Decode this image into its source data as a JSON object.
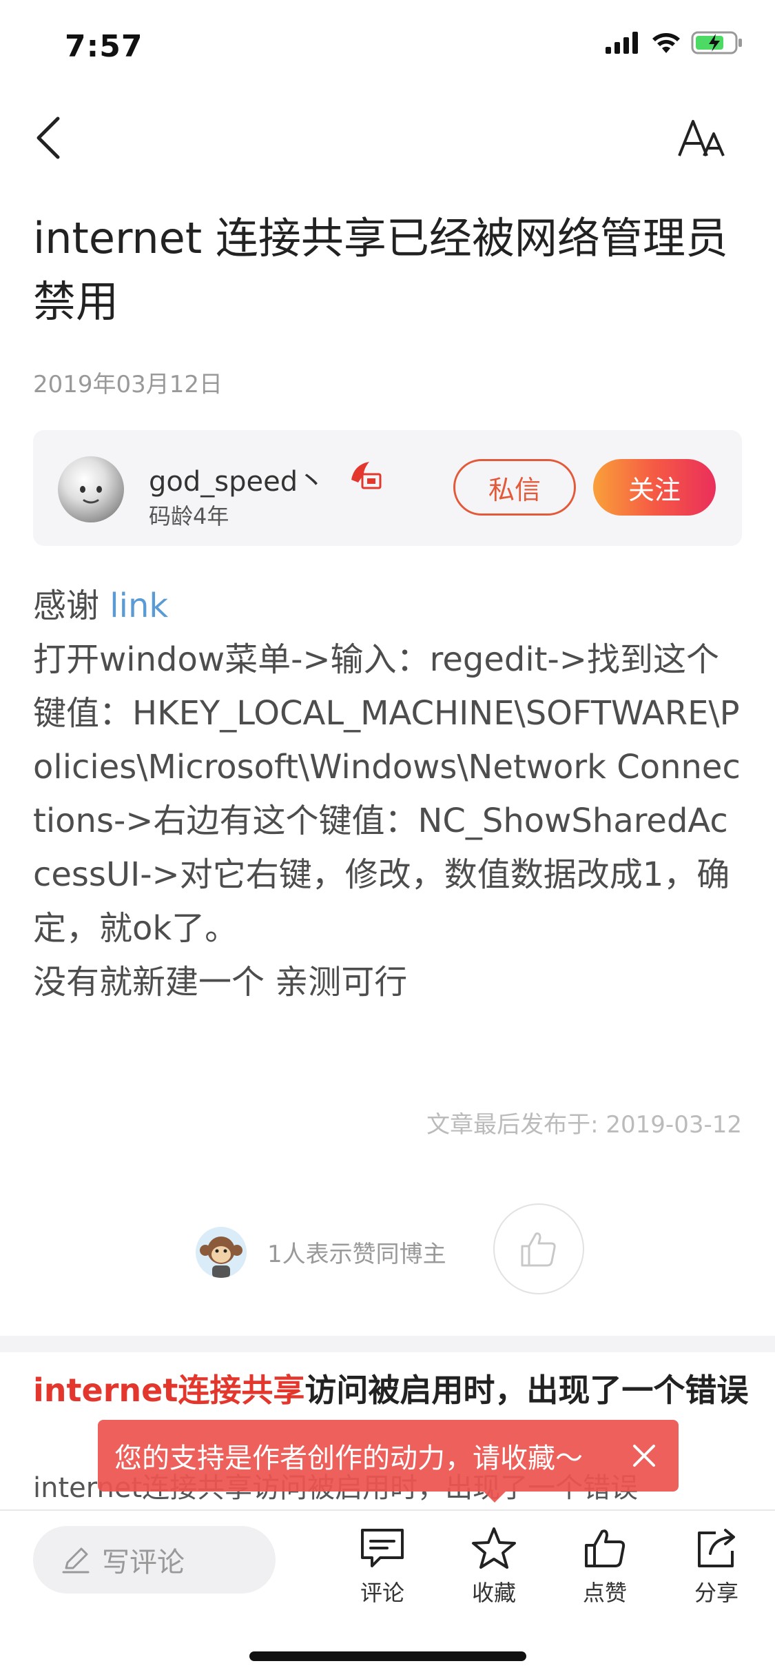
{
  "status_bar": {
    "time": "7:57"
  },
  "nav": {
    "back_icon": "chevron-left-icon",
    "font_icon": "font-size-icon"
  },
  "article": {
    "title": "internet 连接共享已经被网络管理员禁用",
    "date": "2019年03月12日",
    "body": {
      "line1_prefix": "感谢 ",
      "line1_link": "link",
      "paragraph": "打开window菜单->输入：regedit->找到这个键值：HKEY_LOCAL_MACHINE\\SOFTWARE\\Policies\\Microsoft\\Windows\\Network Connections->右边有这个键值：NC_ShowSharedAccessUI->对它右键，修改，数值数据改成1，确定，就ok了。",
      "last_line": "没有就新建一个 亲测可行"
    },
    "published": "文章最后发布于: 2019-03-12"
  },
  "author": {
    "name": "god_speed丶",
    "age": "码龄4年",
    "message_label": "私信",
    "follow_label": "关注"
  },
  "likes": {
    "text": "1人表示赞同博主"
  },
  "related": {
    "title_highlight": "internet连接共享",
    "title_rest": "访问被启用时，出现了一个错误",
    "snippet": "internet连接共享访问被启用时，出现了一个错误"
  },
  "toast": {
    "text": "您的支持是作者创作的动力，请收藏～"
  },
  "bottom_bar": {
    "comment_placeholder": "写评论",
    "tools": [
      {
        "label": "评论",
        "icon": "comment-icon"
      },
      {
        "label": "收藏",
        "icon": "star-icon"
      },
      {
        "label": "点赞",
        "icon": "thumbs-up-icon"
      },
      {
        "label": "分享",
        "icon": "share-icon"
      }
    ]
  },
  "colors": {
    "accent_red": "#e3372e",
    "link_blue": "#5b9bd5",
    "follow_gradient_start": "#f9a03a",
    "follow_gradient_end": "#ea2f5b"
  }
}
